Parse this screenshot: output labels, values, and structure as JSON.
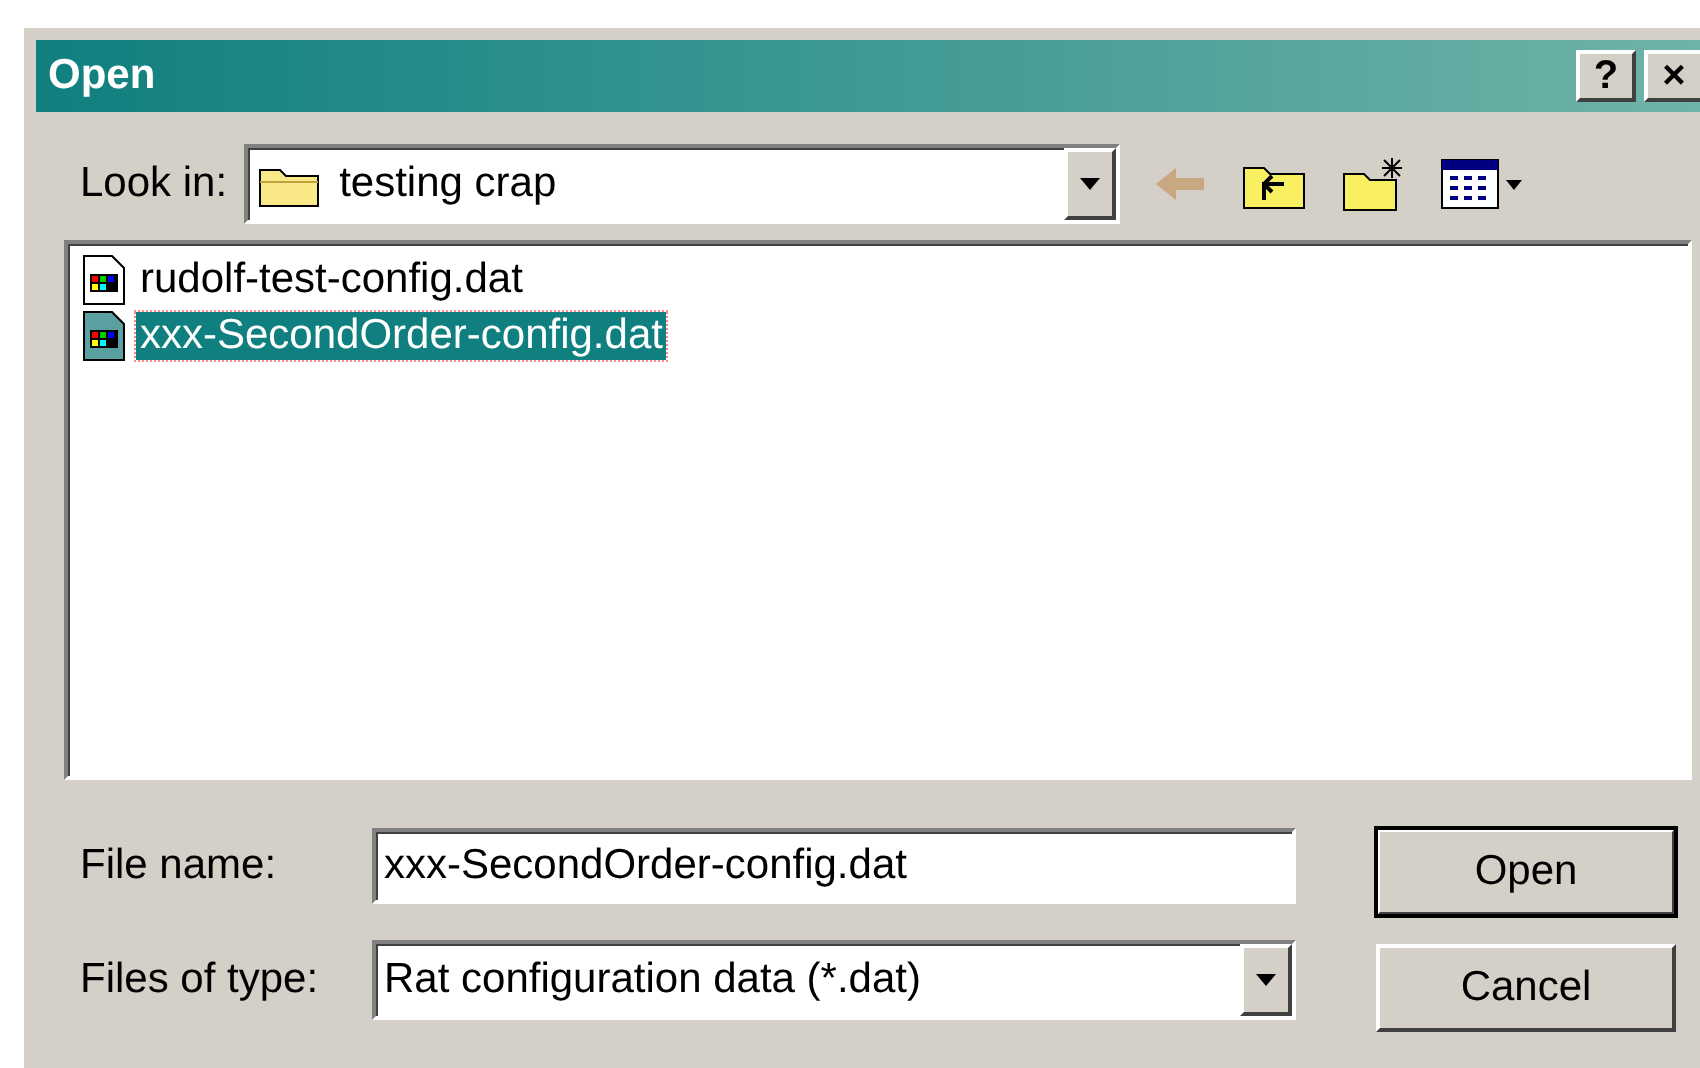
{
  "window": {
    "title": "Open",
    "buttons": [
      "?",
      "×"
    ]
  },
  "look_in": {
    "label": "Look in:",
    "value": "testing crap"
  },
  "toolbar": [
    {
      "kind": "back"
    },
    {
      "kind": "up-folder"
    },
    {
      "kind": "new-folder"
    },
    {
      "kind": "view-menu"
    }
  ],
  "files": [
    {
      "name": "rudolf-test-config.dat",
      "selected": false
    },
    {
      "name": "xxx-SecondOrder-config.dat",
      "selected": true
    }
  ],
  "file_name": {
    "label": "File name:",
    "value": "xxx-SecondOrder-config.dat"
  },
  "file_type": {
    "label": "Files of type:",
    "value": "Rat configuration data (*.dat)"
  },
  "buttons": [
    {
      "label": "Open",
      "default": true
    },
    {
      "label": "Cancel",
      "default": false
    }
  ]
}
